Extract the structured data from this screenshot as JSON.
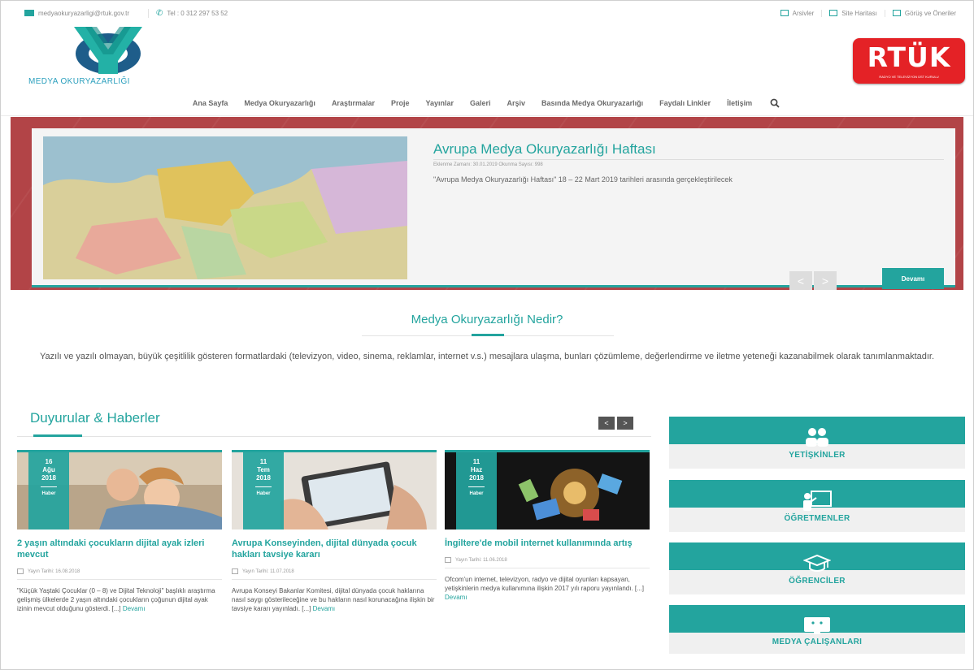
{
  "topbar": {
    "email": "medyaokuryazarligi@rtuk.gov.tr",
    "phone": "Tel : 0 312 297 53 52",
    "links": [
      "Arsivler",
      "Site Haritası",
      "Görüş ve Öneriler"
    ]
  },
  "logo": {
    "text": "MEDYA OKURYAZARLIĞI"
  },
  "rtuk": {
    "title": "RTÜK",
    "subtitle": "RADYO VE TELEVİZYON ÜST KURULU"
  },
  "nav": {
    "items": [
      "Ana Sayfa",
      "Medya Okuryazarlığı",
      "Araştırmalar",
      "Proje",
      "Yayınlar",
      "Galeri",
      "Arşiv",
      "Basında Medya Okuryazarlığı",
      "Faydalı Linkler",
      "İletişim"
    ]
  },
  "slider": {
    "title": "Avrupa Medya Okuryazarlığı Haftası",
    "meta": "Eklenme Zamanı: 30.01.2019   Okunma Sayısı: 998",
    "description": "\"Avrupa Medya Okuryazarlığı Haftası\" 18 – 22 Mart 2019 tarihleri arasında gerçekleştirilecek",
    "prev": "<",
    "next": ">",
    "more": "Devamı"
  },
  "what_is": {
    "title": "Medya Okuryazarlığı Nedir?",
    "description": "Yazılı ve yazılı olmayan, büyük çeşitlilik gösteren formatlardaki (televizyon, video, sinema, reklamlar, internet v.s.) mesajlara ulaşma, bunları çözümleme, değerlendirme ve iletme yeteneği kazanabilmek olarak tanımlanmaktadır."
  },
  "news": {
    "title": "Duyurular & Haberler",
    "prev": "<",
    "next": ">",
    "items": [
      {
        "day": "16",
        "month": "Ağu",
        "year": "2018",
        "category": "Haber",
        "title": "2 yaşın altındaki çocukların dijital ayak izleri mevcut",
        "date": "Yayın Tarihi: 16.08.2018",
        "text": "\"Küçük Yaştaki Çocuklar (0 – 8) ve Dijital Teknoloji\" başlıklı araştırma gelişmiş ülkelerde 2 yaşın altındaki çocukların çoğunun dijital ayak izinin mevcut olduğunu gösterdi. [...] ",
        "more": "Devamı"
      },
      {
        "day": "11",
        "month": "Tem",
        "year": "2018",
        "category": "Haber",
        "title": "Avrupa Konseyinden, dijital dünyada çocuk hakları tavsiye kararı",
        "date": "Yayın Tarihi: 11.07.2018",
        "text": "Avrupa Konseyi Bakanlar Komitesi, dijital dünyada çocuk haklarına nasıl saygı gösterileceğine ve bu hakların nasıl korunacağına ilişkin bir tavsiye kararı yayınladı. [...] ",
        "more": "Devamı"
      },
      {
        "day": "11",
        "month": "Haz",
        "year": "2018",
        "category": "Haber",
        "title": "İngiltere'de mobil internet kullanımında artış",
        "date": "Yayın Tarihi: 11.06.2018",
        "text": "Ofcom'un internet, televizyon, radyo ve dijital oyunları kapsayan, yetişkinlerin medya kullanımına ilişkin 2017 yılı raporu yayınlandı. [...] ",
        "more": "Devamı"
      }
    ]
  },
  "audiences": [
    {
      "label": "YETİŞKİNLER",
      "icon": "adults-icon"
    },
    {
      "label": "ÖĞRETMENLER",
      "icon": "teacher-icon"
    },
    {
      "label": "ÖĞRENCİLER",
      "icon": "graduation-cap-icon"
    },
    {
      "label": "MEDYA ÇALIŞANLARI",
      "icon": "monitor-icon"
    }
  ]
}
